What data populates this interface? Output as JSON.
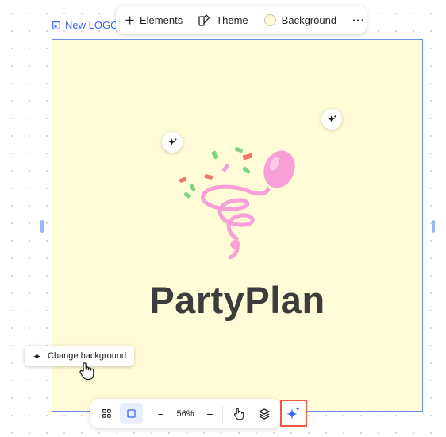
{
  "frame_label": {
    "text": "New LOGO",
    "icon": "frame-icon"
  },
  "top_toolbar": {
    "elements_label": "Elements",
    "theme_label": "Theme",
    "background_label": "Background",
    "more_label": "···",
    "background_swatch_color": "#fdf9d4"
  },
  "canvas": {
    "background_color": "#fffcd7",
    "brand_text": "PartyPlan",
    "logo_icon": "balloon-confetti-icon",
    "accent_pink": "#f7a0d8",
    "confetti_colors": [
      "#f2736a",
      "#7ed481",
      "#f7a0d8"
    ]
  },
  "change_background": {
    "label": "Change background",
    "icon": "sparkle-icon"
  },
  "bottom_toolbar": {
    "grid_icon": "grid-icon",
    "frame_icon": "square-icon",
    "zoom_out": "−",
    "zoom_value": "56%",
    "zoom_in": "+",
    "hand_icon": "hand-icon",
    "layers_icon": "layers-icon",
    "ai_icon": "ai-sparkle-icon"
  },
  "colors": {
    "selection": "#6b8df0",
    "link_blue": "#3b66f5",
    "highlight": "#f05a3c"
  }
}
